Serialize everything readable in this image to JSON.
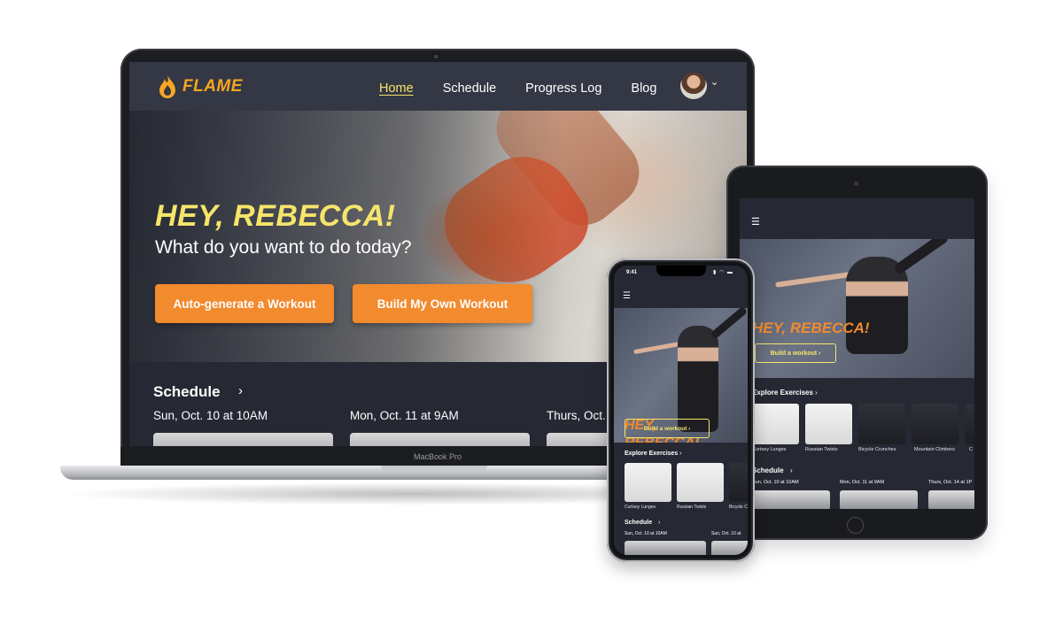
{
  "laptop": {
    "brand_label": "MacBook Pro",
    "logo_text": "FLAME",
    "nav": {
      "items": [
        {
          "label": "Home",
          "active": true
        },
        {
          "label": "Schedule",
          "active": false
        },
        {
          "label": "Progress Log",
          "active": false
        },
        {
          "label": "Blog",
          "active": false
        }
      ]
    },
    "hero": {
      "greeting": "HEY, REBECCA!",
      "subtitle": "What do you want to do today?",
      "primary_button": "Auto-generate a Workout",
      "secondary_button": "Build My Own Workout"
    },
    "schedule": {
      "title": "Schedule",
      "days": [
        "Sun, Oct. 10 at 10AM",
        "Mon, Oct. 11 at 9AM",
        "Thurs, Oct."
      ]
    }
  },
  "tablet": {
    "greeting": "HEY, REBECCA!",
    "button": "Build a workout  ›",
    "explore_title": "Explore Exercises",
    "exercises": [
      "Curtsey Lunges",
      "Russian Twists",
      "Bicycle Crunches",
      "Mountain Climbers",
      "C"
    ],
    "schedule_title": "Schedule",
    "schedule_days": [
      "Sun, Oct. 10 at 10AM",
      "Mon, Oct. 11 at 9AM",
      "Thurs, Oct. 14 at 1P"
    ]
  },
  "phone": {
    "time": "9:41",
    "greeting": "HEY, REBECCA!",
    "button": "Build a workout  ›",
    "explore_title": "Explore Exercises",
    "exercises": [
      "Curtsey Lunges",
      "Russian Twists",
      "Bicycle C"
    ],
    "schedule_title": "Schedule",
    "schedule_days": [
      "Sun, Oct. 10 at 10AM",
      "Sun, Oct. 10 at"
    ]
  },
  "colors": {
    "accent_orange": "#f28a2e",
    "accent_yellow": "#f5e56b",
    "nav_bg": "#343744",
    "page_bg": "#262833"
  },
  "icons": [
    "flame-logo-icon",
    "avatar",
    "chevron-down-icon",
    "chevron-right-icon",
    "menu-icon",
    "wifi-icon",
    "battery-icon"
  ]
}
